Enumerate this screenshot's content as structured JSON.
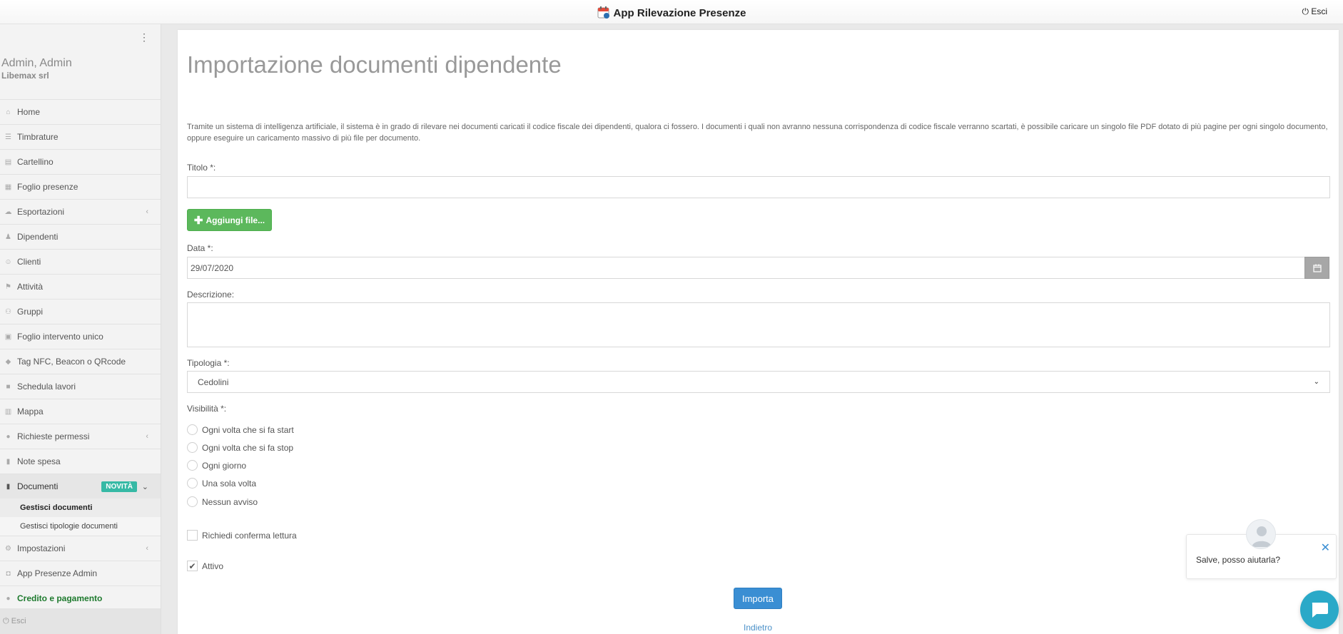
{
  "topbar": {
    "title": "App Rilevazione Presenze",
    "logout_label": "Esci"
  },
  "sidebar": {
    "user_name": "Admin, Admin",
    "company": "Libemax srl",
    "items": [
      {
        "label": "Home",
        "icon": "home-icon"
      },
      {
        "label": "Timbrature",
        "icon": "list-icon"
      },
      {
        "label": "Cartellino",
        "icon": "card-icon"
      },
      {
        "label": "Foglio presenze",
        "icon": "grid-icon"
      },
      {
        "label": "Esportazioni",
        "icon": "cloud-icon"
      },
      {
        "label": "Dipendenti",
        "icon": "person-icon"
      },
      {
        "label": "Clienti",
        "icon": "users-icon"
      },
      {
        "label": "Attività",
        "icon": "signpost-icon"
      },
      {
        "label": "Gruppi",
        "icon": "group-icon"
      },
      {
        "label": "Foglio intervento unico",
        "icon": "form-icon"
      },
      {
        "label": "Tag NFC, Beacon o QRcode",
        "icon": "tag-icon"
      },
      {
        "label": "Schedula lavori",
        "icon": "briefcase-icon"
      },
      {
        "label": "Mappa",
        "icon": "map-icon"
      },
      {
        "label": "Richieste permessi",
        "icon": "chat-icon"
      },
      {
        "label": "Note spesa",
        "icon": "receipt-icon"
      },
      {
        "label": "Documenti",
        "icon": "document-icon",
        "badge": "NOVITÀ"
      },
      {
        "label": "Impostazioni",
        "icon": "cogs-icon"
      },
      {
        "label": "App Presenze Admin",
        "icon": "binoculars-icon"
      },
      {
        "label": "Credito e pagamento",
        "icon": "credit-icon"
      }
    ],
    "subitems": [
      {
        "label": "Gestisci documenti"
      },
      {
        "label": "Gestisci tipologie documenti"
      }
    ],
    "footer_label": "Esci"
  },
  "main": {
    "title": "Importazione documenti dipendente",
    "intro": "Tramite un sistema di intelligenza artificiale, il sistema è in grado di rilevare nei documenti caricati il codice fiscale dei dipendenti, qualora ci fossero. I documenti i quali non avranno nessuna corrispondenza di codice fiscale verranno scartati, è possibile caricare un singolo file PDF dotato di più pagine per ogni singolo documento, oppure eseguire un caricamento massivo di più file per documento.",
    "title_label": "Titolo *:",
    "title_value": "",
    "add_file_label": "Aggiungi file...",
    "date_label": "Data *:",
    "date_value": "29/07/2020",
    "description_label": "Descrizione:",
    "type_label": "Tipologia *:",
    "type_value": "Cedolini",
    "visibility_label": "Visibilità *:",
    "visibility_options": [
      "Ogni volta che si fa start",
      "Ogni volta che si fa stop",
      "Ogni giorno",
      "Una sola volta",
      "Nessun avviso"
    ],
    "confirm_read_label": "Richiedi conferma lettura",
    "active_label": "Attivo",
    "active_checked": true,
    "import_label": "Importa",
    "back_label": "Indietro"
  },
  "chat": {
    "message": "Salve, posso aiutarla?"
  },
  "colors": {
    "primary": "#3a8ed3",
    "success": "#5cb85c",
    "badge": "#36b9a5",
    "chat": "#2aa9c8"
  }
}
